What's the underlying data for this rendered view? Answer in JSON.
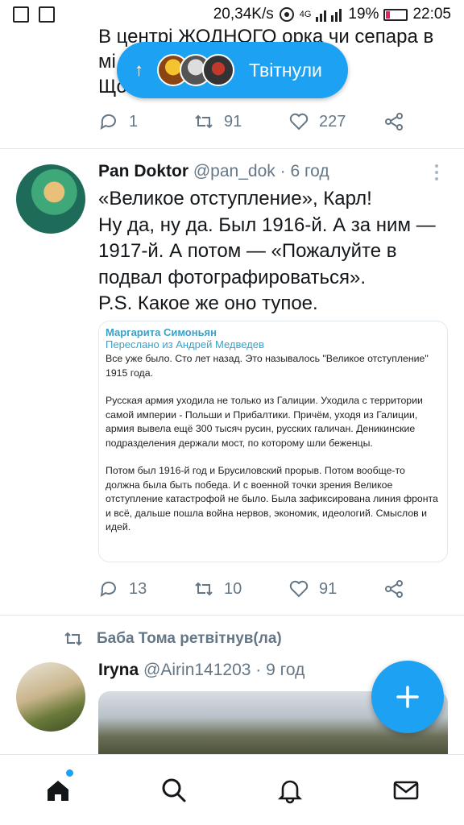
{
  "status_bar": {
    "speed": "20,34K/s",
    "network": "4G",
    "battery": "19%",
    "battery_level": 0.19,
    "time": "22:05"
  },
  "top_tweet": {
    "text_lines": [
      "В центрі ЖОДНОГО орка чи сепара в",
      "мі",
      "Що"
    ],
    "reply_count": "1",
    "retweet_count": "91",
    "like_count": "227"
  },
  "new_tweets_pill": {
    "label": "Твітнули",
    "arrow": "↑"
  },
  "tweet": {
    "name": "Pan Doktor",
    "handle": "@pan_dok",
    "time": "6 год",
    "lines": [
      "«Великое отступление», Карл!",
      "Ну да, ну да. Был 1916-й. А за ним —",
      "1917-й. А потом — «Пожалуйте в",
      "подвал фотографироваться».",
      "P.S. Какое же оно тупое."
    ],
    "image": {
      "author": "Маргарита Симоньян",
      "forwarded": "Переслано из Андрей Медведев",
      "paragraphs": [
        "Все уже было. Сто лет назад.  Это называлось \"Великое отступление\" 1915 года.",
        "Русская армия уходила не только из Галиции. Уходила с территории  самой империи  - Польши и Прибалтики. Причём, уходя из Галиции, армия вывела ещё 300 тысяч русин, русских галичан. Деникинские подразделения держали мост, по которому шли беженцы.",
        "Потом был 1916-й год и Брусиловский прорыв. Потом вообще-то должна была быть победа. И с военной точки зрения Великое отступление катастрофой не было. Была зафиксирована линия фронта и всё, дальше пошла война нервов, экономик, идеологий. Смыслов и идей."
      ]
    },
    "reply_count": "13",
    "retweet_count": "10",
    "like_count": "91"
  },
  "retweet_notice": {
    "text": "Баба Тома ретвітнув(ла)"
  },
  "third_tweet": {
    "name": "Iryna",
    "handle": "@Airin141203",
    "time": "9 год"
  },
  "nav": {
    "items": [
      "home-icon",
      "search-icon",
      "notifications-icon",
      "messages-icon"
    ]
  },
  "colors": {
    "accent": "#1da1f2",
    "muted": "#657786",
    "text": "#14171a",
    "divider": "#e1e8ed"
  }
}
